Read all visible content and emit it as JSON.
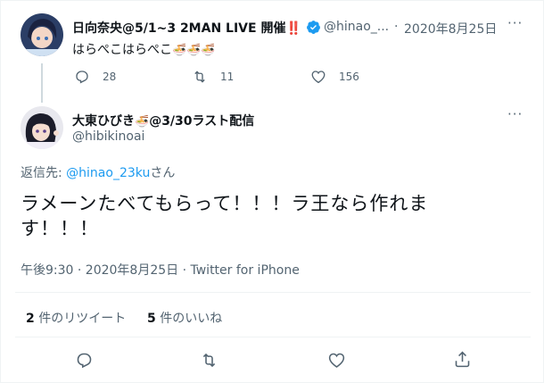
{
  "parent": {
    "display_name": "日向奈央@5/1~3 2MAN LIVE 開催",
    "badge_emoji": "‼️",
    "handle": "@hinao_...",
    "separator": "·",
    "date": "2020年8月25日",
    "text": "はらぺこはらぺこ",
    "text_emoji": "🍜🍜🍜",
    "replies": "28",
    "retweets": "11",
    "likes": "156",
    "more": "···"
  },
  "tweet": {
    "display_name_pre": "大東ひびき",
    "display_name_emoji": "🍜",
    "display_name_post": "@3/30ラスト配信",
    "handle": "@hibikinoai",
    "more": "···",
    "reply_to_label": "返信先:",
    "reply_to_handle": "@hinao_23ku",
    "reply_to_suffix": "さん",
    "body_line1": "ラメーンたべてもらって！！！ラ王なら作れま",
    "body_line2": "す！！！",
    "meta": "午後9:30 · 2020年8月25日 · Twitter for iPhone",
    "retweet_count": "2",
    "retweet_label": "件のリツイート",
    "like_count": "5",
    "like_label": "件のいいね"
  },
  "colors": {
    "accent": "#1d9bf0",
    "muted": "#536471",
    "badge": "#e0245e"
  }
}
